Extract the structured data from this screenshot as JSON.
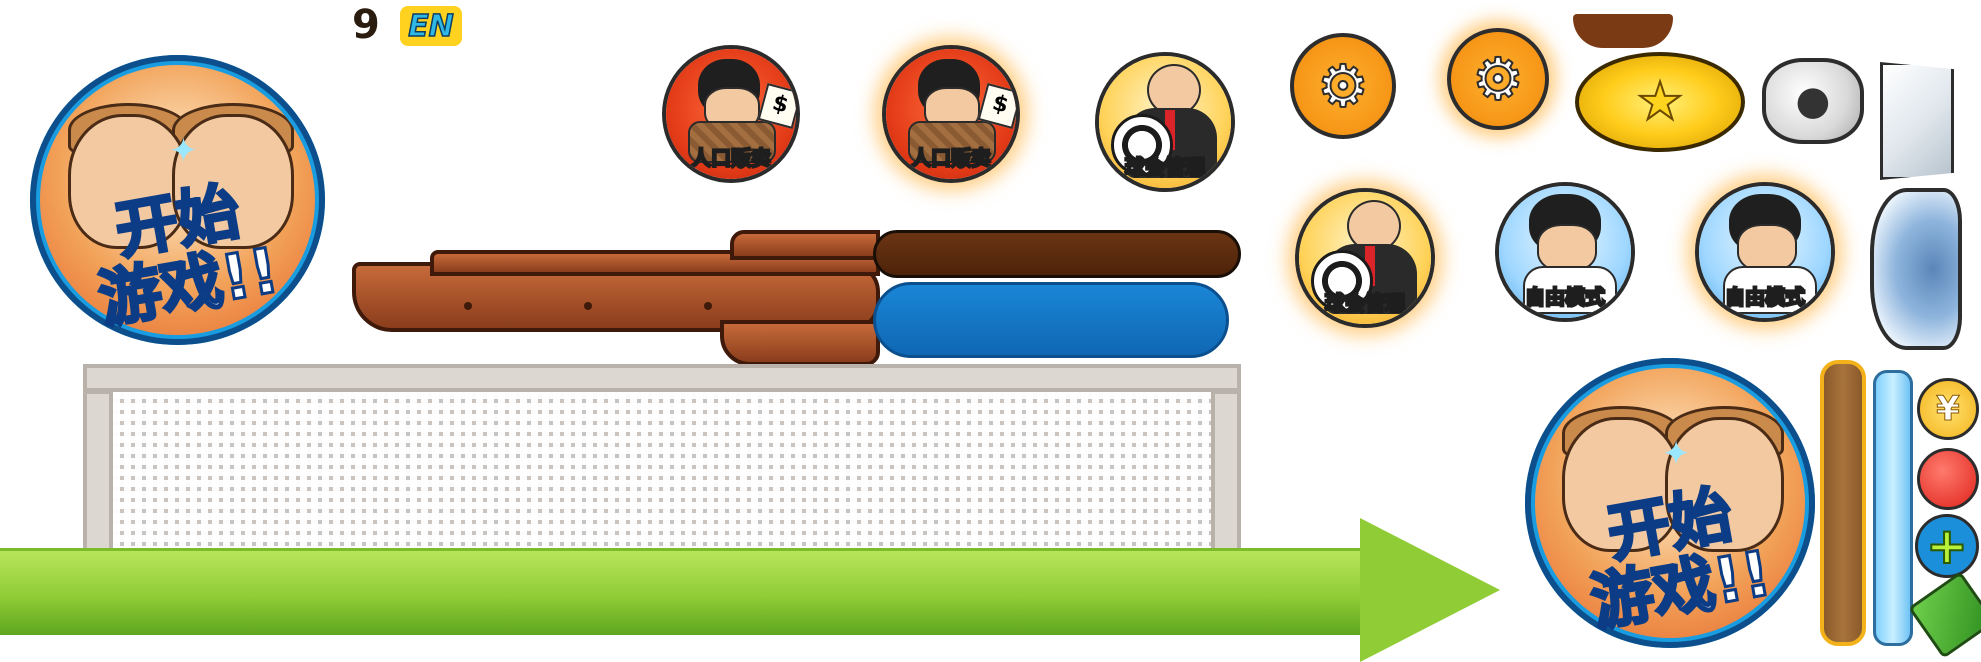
{
  "language": {
    "number": "9",
    "code": "EN"
  },
  "start_button": {
    "label_line1": "开始",
    "label_line2": "游戏",
    "exclaim": "!!"
  },
  "menu_icons": {
    "human_trafficking": "人口贩卖",
    "club_management": "球会管理",
    "free_mode": "自由模式",
    "price_tag": "$"
  },
  "icons": {
    "settings": "gear-icon",
    "lock": "lock-icon",
    "envelope": "envelope-icon",
    "crystal": "crystal-icon",
    "yen_coin": "¥",
    "record": "record-icon",
    "add": "+",
    "cash": "cash-icon"
  },
  "colors": {
    "blue_bar": "#1273c6",
    "brown_bar": "#5a2a10",
    "gold": "#ffcc1a",
    "grass": "#8fcc36"
  }
}
